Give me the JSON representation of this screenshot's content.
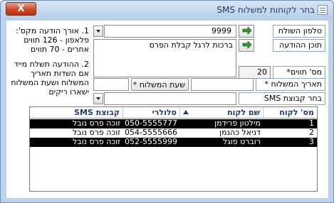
{
  "window": {
    "title": "בחר לקוחות למשלוח SMS",
    "close_label": "X"
  },
  "fields": {
    "phone_label": "טלפון השולח",
    "phone_value": "9999",
    "content_label": "תוכן ההודעה",
    "content_value": "ברכות לרגל קבלת הפרס",
    "msg_length_label": "מס' תווים*",
    "msg_length_value": "20",
    "send_date_label": "תאריך המשלוח *",
    "send_date_value": "",
    "send_time_label": "שעת המשלוח *",
    "send_time_value": "",
    "group_label": "בחר קבוצת SMS",
    "group_value": ""
  },
  "notes": {
    "note1_lines": [
      "1. אורך הודעה מקס':",
      "פלאפון - 126 תווים",
      "אחרים - 70 תווים"
    ],
    "note2_lines": [
      "2. ההודעה תשלח מייד",
      "אם השדות תאריך",
      "המשלוח ושעת המשלוח",
      "ישארו ריקים"
    ]
  },
  "grid": {
    "headers": {
      "customer_no": "מס' לקוח",
      "customer_name": "שם לקוח",
      "mobile": "סלולרי",
      "sms_group": "קבוצת SMS"
    },
    "rows": [
      {
        "customer_no": "1",
        "customer_name": "מילטון פרידמן",
        "mobile": "050-5555777",
        "sms_group": "זוכה פרס נובל",
        "selected": true
      },
      {
        "customer_no": "2",
        "customer_name": "דניאל כהנמן",
        "mobile": "054-5555666",
        "sms_group": "זוכה פרס נובל",
        "selected": false
      },
      {
        "customer_no": "3",
        "customer_name": "רוברט פוגל",
        "mobile": "052-5555999",
        "sms_group": "זוכה פרס נובל",
        "selected": true
      }
    ]
  },
  "icons": {
    "app": "form-icon",
    "go": "green-arrow-icon",
    "sort": "sort-ascending-icon"
  }
}
